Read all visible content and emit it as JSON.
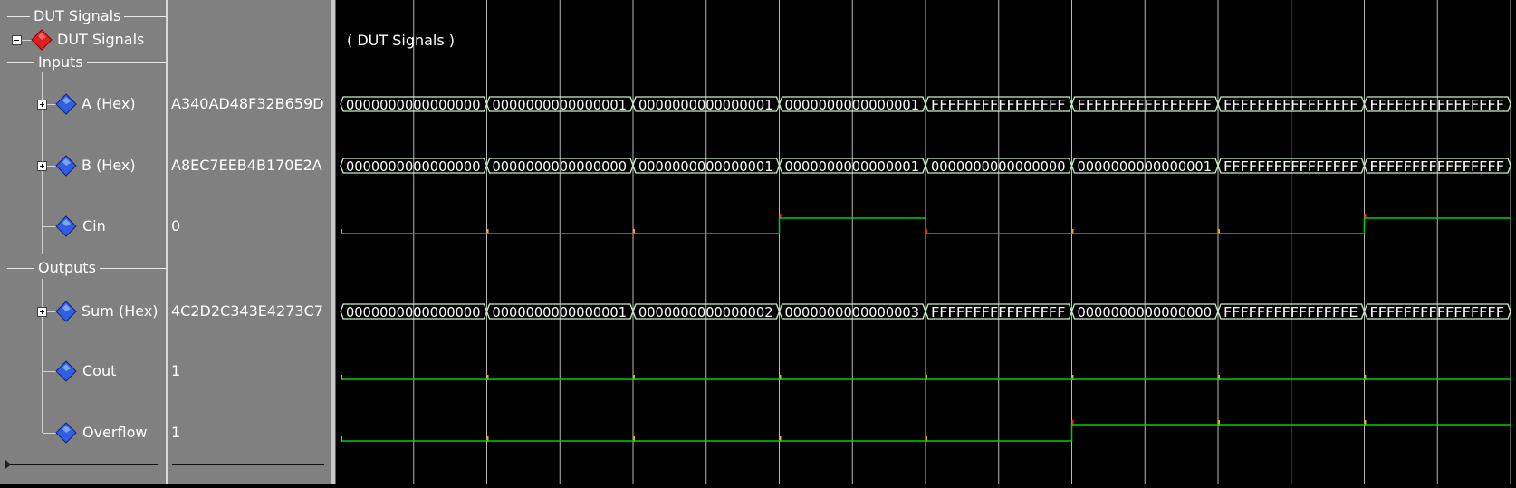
{
  "signal_tree": {
    "group_header": "DUT Signals",
    "group_label": "DUT Signals",
    "inputs_header": "Inputs",
    "outputs_header": "Outputs",
    "signals": [
      {
        "id": "a",
        "label": "A (Hex)",
        "value": "A340AD48F32B659D",
        "expandable": true
      },
      {
        "id": "b",
        "label": "B (Hex)",
        "value": "A8EC7EEB4B170E2A",
        "expandable": true
      },
      {
        "id": "cin",
        "label": "Cin",
        "value": "0",
        "expandable": false
      },
      {
        "id": "sum",
        "label": "Sum (Hex)",
        "value": "4C2D2C343E4273C7",
        "expandable": true
      },
      {
        "id": "cout",
        "label": "Cout",
        "value": "1",
        "expandable": false
      },
      {
        "id": "overflow",
        "label": "Overflow",
        "value": "1",
        "expandable": false
      }
    ]
  },
  "waveform": {
    "group_label": "( DUT Signals )",
    "colors": {
      "bus": "#c8f0c8",
      "bit": "#00d000",
      "edge_marker": "#ff2020",
      "grid": "#d8d8d8",
      "tick": "#ffa000"
    },
    "buses": {
      "a": [
        "0000000000000000",
        "0000000000000001",
        "0000000000000001",
        "0000000000000001",
        "FFFFFFFFFFFFFFFF",
        "FFFFFFFFFFFFFFFF",
        "FFFFFFFFFFFFFFFF",
        "FFFFFFFFFFFFFFFF"
      ],
      "b": [
        "0000000000000000",
        "0000000000000000",
        "0000000000000001",
        "0000000000000001",
        "0000000000000000",
        "0000000000000001",
        "FFFFFFFFFFFFFFFF",
        "FFFFFFFFFFFFFFFF"
      ],
      "sum": [
        "0000000000000000",
        "0000000000000001",
        "0000000000000002",
        "0000000000000003",
        "FFFFFFFFFFFFFFFF",
        "0000000000000000",
        "FFFFFFFFFFFFFFFE",
        "FFFFFFFFFFFFFFFF"
      ]
    },
    "bits": {
      "cin": [
        0,
        0,
        0,
        1,
        0,
        0,
        0,
        1
      ],
      "cout": [
        0,
        0,
        0,
        0,
        0,
        0,
        0,
        0
      ],
      "overflow": [
        0,
        0,
        0,
        0,
        0,
        1,
        1,
        1
      ]
    }
  }
}
